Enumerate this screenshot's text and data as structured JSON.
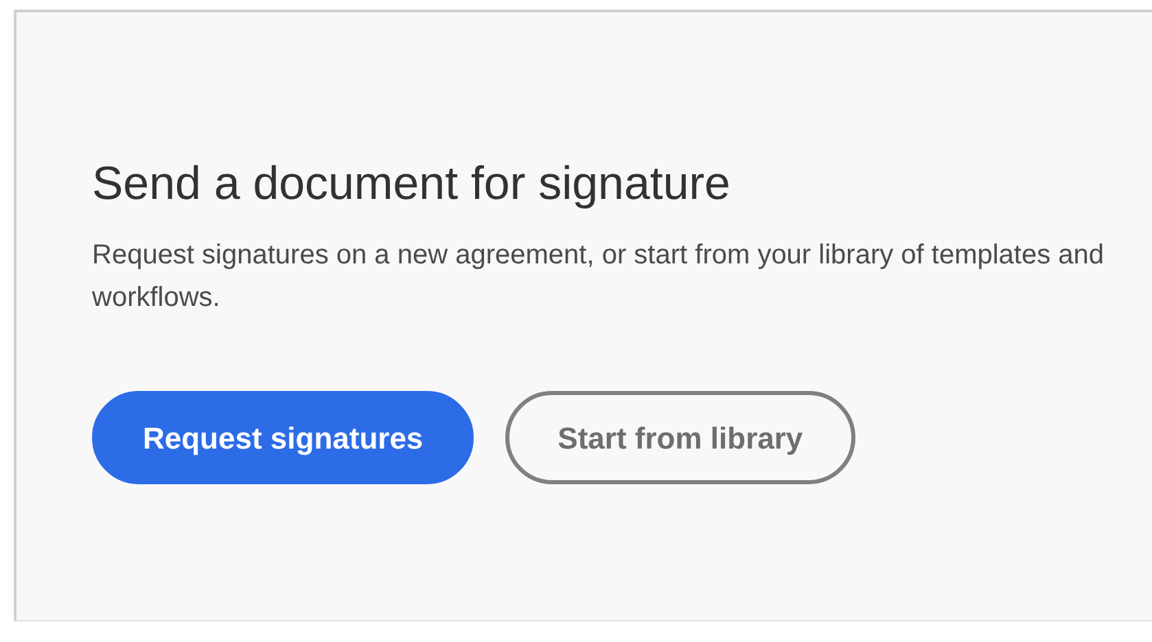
{
  "card": {
    "title": "Send a document for signature",
    "description": "Request signatures on a new agreement, or start from your library of templates and workflows.",
    "buttons": [
      {
        "label": "Request signatures",
        "kind": "primary"
      },
      {
        "label": "Start from library",
        "kind": "secondary"
      }
    ]
  }
}
